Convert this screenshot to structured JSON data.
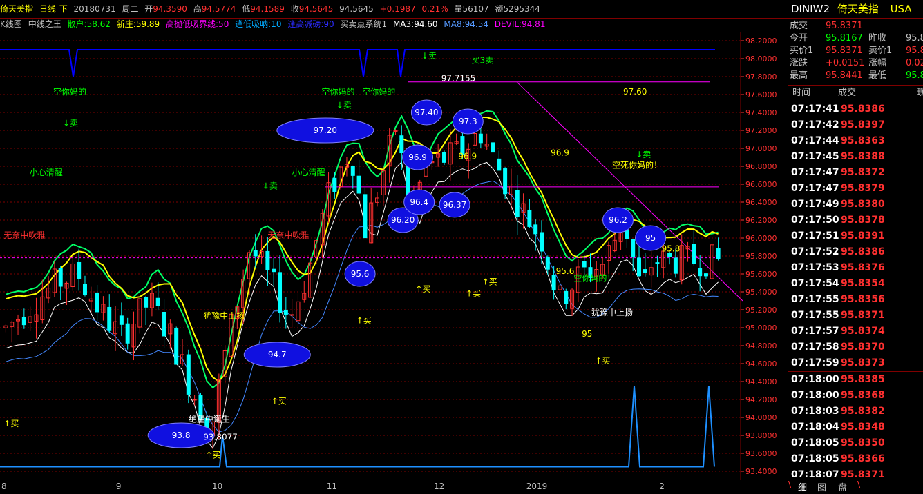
{
  "header": {
    "title": "倚天美指",
    "period": "日线",
    "arrow": "下",
    "date": "20180731",
    "weekday": "周二",
    "open_label": "开",
    "open": "94.3590",
    "high_label": "高",
    "high": "94.5774",
    "low_label": "低",
    "low": "94.1589",
    "close_label": "收",
    "close": "94.5645",
    "last": "94.5645",
    "change": "+0.1987",
    "change_pct": "0.21%",
    "volume_label": "量",
    "volume": "56107",
    "amount_label": "额",
    "amount": "5295344"
  },
  "indicators": [
    {
      "text": "K线图",
      "color": "#c0c0c0"
    },
    {
      "text": "中线之王",
      "color": "#c0c0c0"
    },
    {
      "text": "散户:58.62",
      "color": "#00ff00"
    },
    {
      "text": "新庄:59.89",
      "color": "#ffff00"
    },
    {
      "text": "高抛低吸界线:50",
      "color": "#ff00ff"
    },
    {
      "text": "逢低吸呐:10",
      "color": "#00aaff"
    },
    {
      "text": "逢高减磅:90",
      "color": "#0000ff"
    },
    {
      "text": "买卖点系统1",
      "color": "#c0c0c0"
    },
    {
      "text": "MA3:94.60",
      "color": "#ffffff"
    },
    {
      "text": "MA8:94.54",
      "color": "#5599ff"
    },
    {
      "text": "DEVIL:94.81",
      "color": "#ff00ff"
    }
  ],
  "colors": {
    "up": "#ff3030",
    "down": "#00ffff",
    "ma3": "#ffffff",
    "ma8": "#4488ff",
    "retail": "#00ff66",
    "dealer": "#ffff00",
    "band": "#0000ff",
    "grid": "#800000",
    "price_axis": "#ff3030",
    "magenta": "#ff00ff",
    "blue_line": "#1e90ff"
  },
  "price_axis": {
    "ticks": [
      "98.2000",
      "98.0000",
      "97.8000",
      "97.6000",
      "97.4000",
      "97.2000",
      "97.0000",
      "96.8000",
      "96.6000",
      "96.4000",
      "96.2000",
      "96.0000",
      "95.8000",
      "95.6000",
      "95.4000",
      "95.2000",
      "95.0000",
      "94.8000",
      "94.6000",
      "94.4000",
      "94.2000",
      "94.0000",
      "93.8000",
      "93.6000",
      "93.4000"
    ],
    "max": 98.3,
    "min": 93.3
  },
  "x_axis": [
    {
      "label": "8",
      "pos": 0.0
    },
    {
      "label": "9",
      "pos": 0.155
    },
    {
      "label": "10",
      "pos": 0.285
    },
    {
      "label": "11",
      "pos": 0.44
    },
    {
      "label": "12",
      "pos": 0.585
    },
    {
      "label": "2019",
      "pos": 0.71
    },
    {
      "label": "2",
      "pos": 0.89
    }
  ],
  "annotations": {
    "ellipse_labels": [
      {
        "text": "93.8",
        "cx": 0.245,
        "y": 93.8
      },
      {
        "text": "94.7",
        "cx": 0.375,
        "y": 94.7
      },
      {
        "text": "95.6",
        "cx": 0.487,
        "y": 95.6
      },
      {
        "text": "96.20",
        "cx": 0.545,
        "y": 96.2
      },
      {
        "text": "96.4",
        "cx": 0.567,
        "y": 96.4
      },
      {
        "text": "96.37",
        "cx": 0.615,
        "y": 96.37
      },
      {
        "text": "96.9",
        "cx": 0.565,
        "y": 96.9
      },
      {
        "text": "97.20",
        "cx": 0.44,
        "y": 97.2
      },
      {
        "text": "97.40",
        "cx": 0.577,
        "y": 97.4
      },
      {
        "text": "97.3",
        "cx": 0.633,
        "y": 97.3
      },
      {
        "text": "96.2",
        "cx": 0.836,
        "y": 96.2
      },
      {
        "text": "95",
        "cx": 0.88,
        "y": 96.0
      }
    ],
    "text_labels": [
      {
        "text": "空你妈的",
        "x": 0.072,
        "y": 97.6,
        "color": "#00ff00"
      },
      {
        "text": "小心清醒",
        "x": 0.04,
        "y": 96.7,
        "color": "#00ff00"
      },
      {
        "text": "无奈中吹雅",
        "x": 0.005,
        "y": 96.0,
        "color": "#ff3030"
      },
      {
        "text": "犹豫中上扬",
        "x": 0.275,
        "y": 95.1,
        "color": "#ffff00"
      },
      {
        "text": "绝望中诞生",
        "x": 0.255,
        "y": 93.95,
        "color": "#ffffff"
      },
      {
        "text": "93.8077",
        "x": 0.275,
        "y": 93.75,
        "color": "#ffffff"
      },
      {
        "text": "无奈中吹雅",
        "x": 0.362,
        "y": 96.0,
        "color": "#ff3030"
      },
      {
        "text": "小心清醒",
        "x": 0.395,
        "y": 96.7,
        "color": "#00ff00"
      },
      {
        "text": "空你妈的",
        "x": 0.435,
        "y": 97.6,
        "color": "#00ff00"
      },
      {
        "text": "空你妈的",
        "x": 0.49,
        "y": 97.6,
        "color": "#00ff00"
      },
      {
        "text": "97.7155",
        "x": 0.597,
        "y": 97.75,
        "color": "#ffffff"
      },
      {
        "text": "97.60",
        "x": 0.843,
        "y": 97.6,
        "color": "#ffff00"
      },
      {
        "text": "96.9",
        "x": 0.745,
        "y": 96.92,
        "color": "#ffff00"
      },
      {
        "text": "96.9",
        "x": 0.62,
        "y": 96.88,
        "color": "#ffff00"
      },
      {
        "text": "空死你妈的！",
        "x": 0.828,
        "y": 96.78,
        "color": "#ffff00"
      },
      {
        "text": "95.6",
        "x": 0.752,
        "y": 95.6,
        "color": "#ffff00"
      },
      {
        "text": "空你妈的！",
        "x": 0.776,
        "y": 95.52,
        "color": "#00ff00"
      },
      {
        "text": "犹豫中上扬",
        "x": 0.8,
        "y": 95.14,
        "color": "#ffffff"
      },
      {
        "text": "95",
        "x": 0.787,
        "y": 94.9,
        "color": "#ffff00"
      },
      {
        "text": "95.8",
        "x": 0.895,
        "y": 95.85,
        "color": "#ffff00"
      }
    ],
    "buy_signals": [
      {
        "text": "↑买",
        "x": 0.005,
        "y": 93.9
      },
      {
        "text": "↑买",
        "x": 0.278,
        "y": 93.55
      },
      {
        "text": "↑买",
        "x": 0.367,
        "y": 94.15
      },
      {
        "text": "↑买",
        "x": 0.482,
        "y": 95.05
      },
      {
        "text": "↑买",
        "x": 0.562,
        "y": 95.4
      },
      {
        "text": "↑买",
        "x": 0.63,
        "y": 95.35
      },
      {
        "text": "↑买",
        "x": 0.652,
        "y": 95.48
      },
      {
        "text": "↑买",
        "x": 0.805,
        "y": 94.6
      }
    ],
    "sell_signals": [
      {
        "text": "↓卖",
        "x": 0.085,
        "y": 97.25
      },
      {
        "text": "↓卖",
        "x": 0.355,
        "y": 96.55
      },
      {
        "text": "↓卖",
        "x": 0.455,
        "y": 97.45
      },
      {
        "text": "↓卖",
        "x": 0.57,
        "y": 98.0
      },
      {
        "text": "买3卖",
        "x": 0.638,
        "y": 97.95
      },
      {
        "text": "↓卖",
        "x": 0.86,
        "y": 96.9
      }
    ]
  },
  "side": {
    "symbol": "DINIW2",
    "name": "倚天美指",
    "market": "USA",
    "quote": [
      {
        "l1": "成交",
        "v1": "95.8371",
        "c1": "#ff3030",
        "l2": "",
        "v2": "",
        "c2": ""
      },
      {
        "l1": "今开",
        "v1": "95.8167",
        "c1": "#00ff00",
        "l2": "昨收",
        "v2": "95.8",
        "c2": "#c0c0c0"
      },
      {
        "l1": "买价1",
        "v1": "95.8371",
        "c1": "#ff3030",
        "l2": "卖价1",
        "v2": "95.8",
        "c2": "#ff3030"
      },
      {
        "l1": "涨跌",
        "v1": "+0.0151",
        "c1": "#ff3030",
        "l2": "涨幅",
        "v2": "0.02",
        "c2": "#ff3030"
      },
      {
        "l1": "最高",
        "v1": "95.8441",
        "c1": "#ff3030",
        "l2": "最低",
        "v2": "95.8",
        "c2": "#00ff00"
      }
    ],
    "ticks_header": {
      "time": "时间",
      "price": "成交",
      "vol": "现"
    },
    "ticks": [
      {
        "time": "07:17:41",
        "price": "95.8386"
      },
      {
        "time": "07:17:42",
        "price": "95.8397"
      },
      {
        "time": "07:17:44",
        "price": "95.8363"
      },
      {
        "time": "07:17:45",
        "price": "95.8388"
      },
      {
        "time": "07:17:47",
        "price": "95.8372"
      },
      {
        "time": "07:17:47",
        "price": "95.8379"
      },
      {
        "time": "07:17:49",
        "price": "95.8380"
      },
      {
        "time": "07:17:50",
        "price": "95.8378"
      },
      {
        "time": "07:17:51",
        "price": "95.8391"
      },
      {
        "time": "07:17:52",
        "price": "95.8386"
      },
      {
        "time": "07:17:53",
        "price": "95.8376"
      },
      {
        "time": "07:17:54",
        "price": "95.8354"
      },
      {
        "time": "07:17:55",
        "price": "95.8356"
      },
      {
        "time": "07:17:55",
        "price": "95.8371"
      },
      {
        "time": "07:17:57",
        "price": "95.8374"
      },
      {
        "time": "07:17:58",
        "price": "95.8370"
      },
      {
        "time": "07:17:59",
        "price": "95.8373"
      },
      {
        "time": "07:18:00",
        "price": "95.8385"
      },
      {
        "time": "07:18:00",
        "price": "95.8368"
      },
      {
        "time": "07:18:03",
        "price": "95.8382"
      },
      {
        "time": "07:18:04",
        "price": "95.8348"
      },
      {
        "time": "07:18:05",
        "price": "95.8350"
      },
      {
        "time": "07:18:05",
        "price": "95.8366"
      },
      {
        "time": "07:18:07",
        "price": "95.8371"
      }
    ],
    "tabs": [
      "\\",
      "细",
      "图",
      "盘",
      "\\"
    ]
  }
}
